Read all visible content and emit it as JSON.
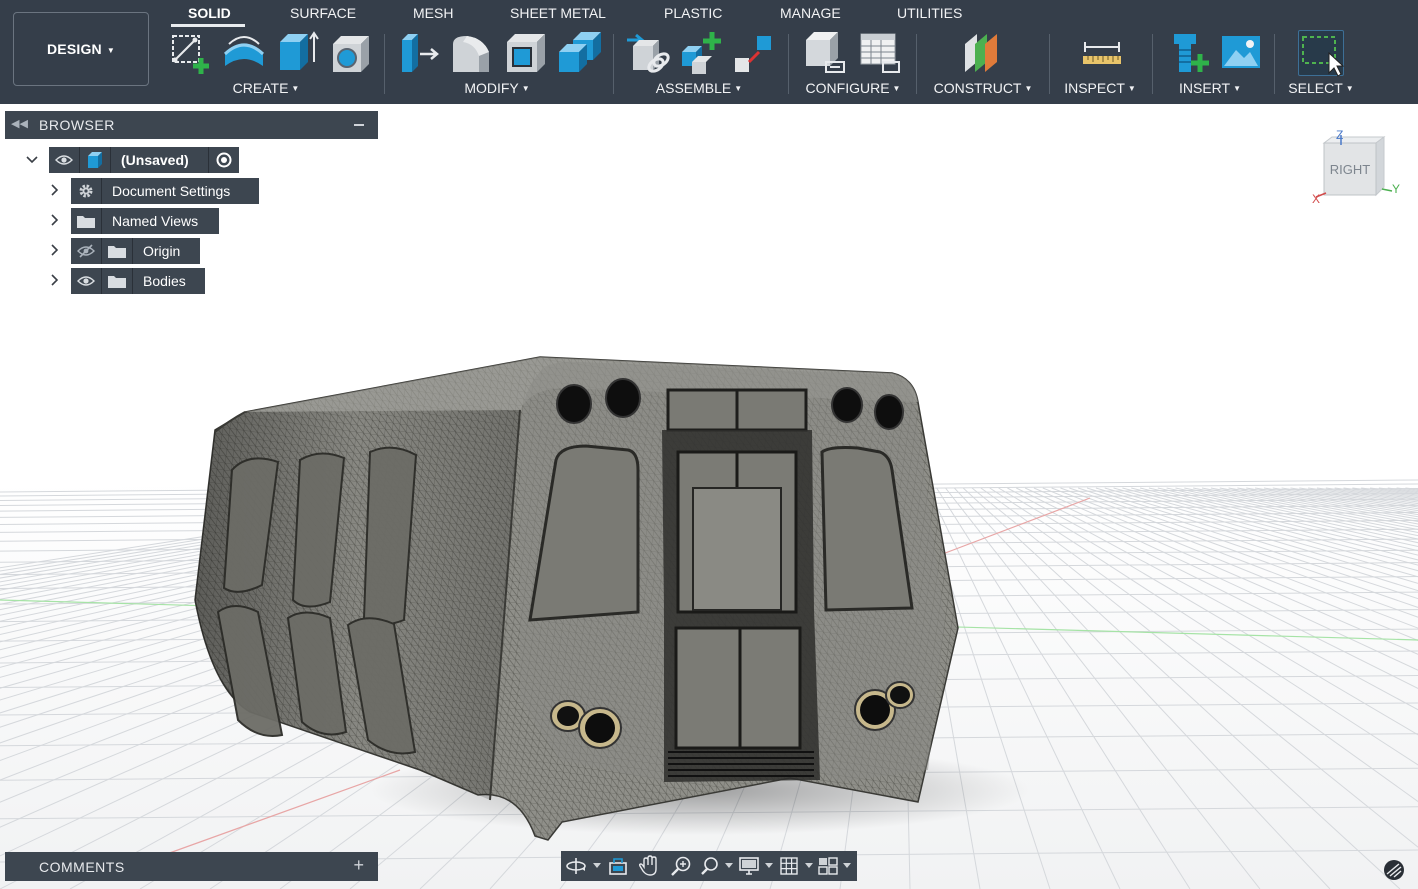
{
  "workspace": {
    "label": "DESIGN"
  },
  "tabs": [
    {
      "label": "SOLID",
      "active": true
    },
    {
      "label": "SURFACE"
    },
    {
      "label": "MESH"
    },
    {
      "label": "SHEET METAL"
    },
    {
      "label": "PLASTIC"
    },
    {
      "label": "MANAGE"
    },
    {
      "label": "UTILITIES"
    }
  ],
  "groups": {
    "create": "CREATE",
    "modify": "MODIFY",
    "assemble": "ASSEMBLE",
    "configure": "CONFIGURE",
    "construct": "CONSTRUCT",
    "inspect": "INSPECT",
    "insert": "INSERT",
    "select": "SELECT"
  },
  "browser": {
    "title": "BROWSER",
    "root": "(Unsaved)",
    "items": [
      {
        "label": "Document Settings",
        "icon": "gear-icon"
      },
      {
        "label": "Named Views",
        "icon": "folder-icon"
      },
      {
        "label": "Origin",
        "icon": "folder-icon",
        "visible": false
      },
      {
        "label": "Bodies",
        "icon": "folder-icon",
        "visible": true
      }
    ]
  },
  "comments": {
    "title": "COMMENTS"
  },
  "viewcube": {
    "face": "RIGHT",
    "axes": [
      "Z",
      "X",
      "Y"
    ]
  },
  "colors": {
    "toolbar": "#353e4a",
    "panel": "#3d4650",
    "accent": "#1f9ad6",
    "green": "#2fb34a"
  }
}
